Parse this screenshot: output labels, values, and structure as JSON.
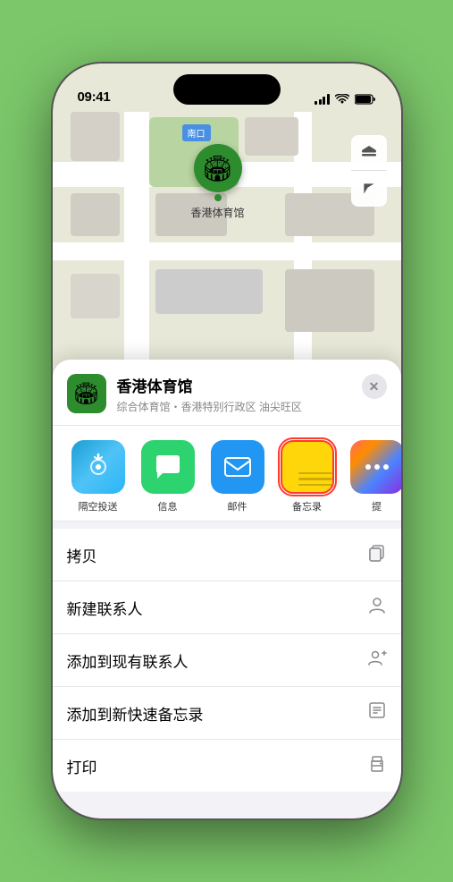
{
  "status_bar": {
    "time": "09:41",
    "location_icon": "▶",
    "signal_bars": [
      3,
      4,
      5,
      6
    ],
    "wifi": "wifi",
    "battery": "battery"
  },
  "map": {
    "label": "南口",
    "stadium_name": "香港体育馆",
    "pin_emoji": "🏟"
  },
  "map_controls": {
    "layers": "🗺",
    "location": "➤"
  },
  "venue": {
    "name": "香港体育馆",
    "subtitle": "综合体育馆・香港特别行政区 油尖旺区",
    "close": "✕"
  },
  "share_items": [
    {
      "id": "airdrop",
      "icon": "📡",
      "label": "隔空投送"
    },
    {
      "id": "message",
      "icon": "💬",
      "label": "信息"
    },
    {
      "id": "mail",
      "icon": "✉️",
      "label": "邮件"
    },
    {
      "id": "notes",
      "icon": "notes",
      "label": "备忘录"
    },
    {
      "id": "more",
      "icon": "···",
      "label": "提"
    }
  ],
  "actions": [
    {
      "label": "拷贝",
      "icon": "⎘"
    },
    {
      "label": "新建联系人",
      "icon": "👤"
    },
    {
      "label": "添加到现有联系人",
      "icon": "👤+"
    },
    {
      "label": "添加到新快速备忘录",
      "icon": "📋"
    },
    {
      "label": "打印",
      "icon": "🖨"
    }
  ]
}
